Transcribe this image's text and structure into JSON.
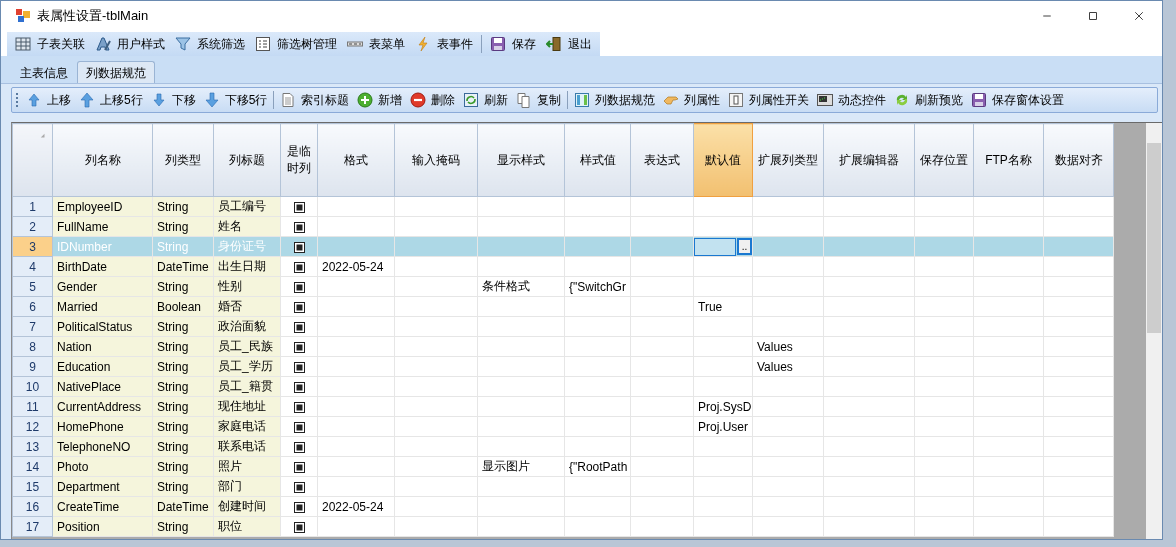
{
  "window": {
    "title": "表属性设置-tblMain"
  },
  "main_toolbar": [
    {
      "kind": "button",
      "label": "子表关联"
    },
    {
      "kind": "button",
      "label": "用户样式"
    },
    {
      "kind": "button",
      "label": "系统筛选"
    },
    {
      "kind": "button",
      "label": "筛选树管理"
    },
    {
      "kind": "button",
      "label": "表菜单"
    },
    {
      "kind": "button",
      "label": "表事件"
    },
    {
      "kind": "separator"
    },
    {
      "kind": "button",
      "label": "保存"
    },
    {
      "kind": "button",
      "label": "退出"
    }
  ],
  "tabs": [
    {
      "label": "主表信息",
      "selected": false
    },
    {
      "label": "列数据规范",
      "selected": true
    }
  ],
  "column_toolbar": [
    {
      "kind": "button",
      "label": "上移"
    },
    {
      "kind": "button",
      "label": "上移5行"
    },
    {
      "kind": "button",
      "label": "下移"
    },
    {
      "kind": "button",
      "label": "下移5行"
    },
    {
      "kind": "separator"
    },
    {
      "kind": "button",
      "label": "索引标题"
    },
    {
      "kind": "button",
      "label": "新增"
    },
    {
      "kind": "button",
      "label": "删除"
    },
    {
      "kind": "button",
      "label": "刷新"
    },
    {
      "kind": "button",
      "label": "复制"
    },
    {
      "kind": "separator"
    },
    {
      "kind": "button",
      "label": "列数据规范"
    },
    {
      "kind": "button",
      "label": "列属性"
    },
    {
      "kind": "button",
      "label": "列属性开关"
    },
    {
      "kind": "button",
      "label": "动态控件"
    },
    {
      "kind": "button",
      "label": "刷新预览"
    },
    {
      "kind": "button",
      "label": "保存窗体设置"
    }
  ],
  "grid": {
    "columns": [
      {
        "label": "列名称",
        "selected": false
      },
      {
        "label": "列类型",
        "selected": false
      },
      {
        "label": "列标题",
        "selected": false
      },
      {
        "label": "是临时列",
        "selected": false
      },
      {
        "label": "格式",
        "selected": false
      },
      {
        "label": "输入掩码",
        "selected": false
      },
      {
        "label": "显示样式",
        "selected": false
      },
      {
        "label": "样式值",
        "selected": false
      },
      {
        "label": "表达式",
        "selected": false
      },
      {
        "label": "默认值",
        "selected": true
      },
      {
        "label": "扩展列类型",
        "selected": false
      },
      {
        "label": "扩展编辑器",
        "selected": false
      },
      {
        "label": "保存位置",
        "selected": false
      },
      {
        "label": "FTP名称",
        "selected": false
      },
      {
        "label": "数据对齐",
        "selected": false
      }
    ],
    "edit_button": "..",
    "rows": [
      {
        "number": "1",
        "selected": false,
        "name": "EmployeeID",
        "type": "String",
        "title": "员工编号",
        "temporary": true
      },
      {
        "number": "2",
        "selected": false,
        "name": "FullName",
        "type": "String",
        "title": "姓名",
        "temporary": true
      },
      {
        "number": "3",
        "selected": true,
        "name": "IDNumber",
        "type": "String",
        "title": "身份证号",
        "temporary": true
      },
      {
        "number": "4",
        "selected": false,
        "name": "BirthDate",
        "type": "DateTime",
        "title": "出生日期",
        "temporary": true,
        "format": "2022-05-24"
      },
      {
        "number": "5",
        "selected": false,
        "name": "Gender",
        "type": "String",
        "title": "性别",
        "temporary": true,
        "display_style": "条件格式",
        "style_value": "{\"SwitchGr"
      },
      {
        "number": "6",
        "selected": false,
        "name": "Married",
        "type": "Boolean",
        "title": "婚否",
        "temporary": true,
        "default_value": "True"
      },
      {
        "number": "7",
        "selected": false,
        "name": "PoliticalStatus",
        "type": "String",
        "title": "政治面貌",
        "temporary": true
      },
      {
        "number": "8",
        "selected": false,
        "name": "Nation",
        "type": "String",
        "title": "员工_民族",
        "temporary": true,
        "ext_column_type": "Values"
      },
      {
        "number": "9",
        "selected": false,
        "name": "Education",
        "type": "String",
        "title": "员工_学历",
        "temporary": true,
        "ext_column_type": "Values"
      },
      {
        "number": "10",
        "selected": false,
        "name": "NativePlace",
        "type": "String",
        "title": "员工_籍贯",
        "temporary": true
      },
      {
        "number": "11",
        "selected": false,
        "name": "CurrentAddress",
        "type": "String",
        "title": "现住地址",
        "temporary": true,
        "default_value": "Proj.SysD"
      },
      {
        "number": "12",
        "selected": false,
        "name": "HomePhone",
        "type": "String",
        "title": "家庭电话",
        "temporary": true,
        "default_value": "Proj.User"
      },
      {
        "number": "13",
        "selected": false,
        "name": "TelephoneNO",
        "type": "String",
        "title": "联系电话",
        "temporary": true
      },
      {
        "number": "14",
        "selected": false,
        "name": "Photo",
        "type": "String",
        "title": "照片",
        "temporary": true,
        "display_style": "显示图片",
        "style_value": "{\"RootPath"
      },
      {
        "number": "15",
        "selected": false,
        "name": "Department",
        "type": "String",
        "title": "部门",
        "temporary": true
      },
      {
        "number": "16",
        "selected": false,
        "name": "CreateTime",
        "type": "DateTime",
        "title": "创建时间",
        "temporary": true,
        "format": "2022-05-24"
      },
      {
        "number": "17",
        "selected": false,
        "name": "Position",
        "type": "String",
        "title": "职位",
        "temporary": true
      }
    ]
  }
}
